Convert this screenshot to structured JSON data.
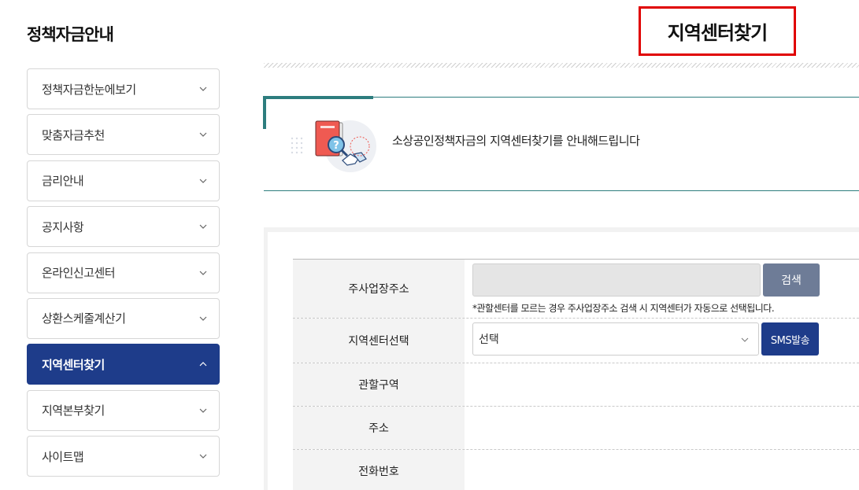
{
  "sidebar": {
    "title": "정책자금안내",
    "items": [
      {
        "label": "정책자금한눈에보기",
        "active": false
      },
      {
        "label": "맞춤자금추천",
        "active": false
      },
      {
        "label": "금리안내",
        "active": false
      },
      {
        "label": "공지사항",
        "active": false
      },
      {
        "label": "온라인신고센터",
        "active": false
      },
      {
        "label": "상환스케줄계산기",
        "active": false
      },
      {
        "label": "지역센터찾기",
        "active": true
      },
      {
        "label": "지역본부찾기",
        "active": false
      },
      {
        "label": "사이트맵",
        "active": false
      }
    ]
  },
  "header": {
    "title": "지역센터찾기"
  },
  "banner": {
    "text": "소상공인정책자금의 지역센터찾기를 안내해드립니다",
    "icon": "book-search-handshake-icon"
  },
  "form": {
    "rows": {
      "address": {
        "label": "주사업장주소",
        "input_value": "",
        "search_label": "검색",
        "hint": "*관할센터를 모르는 경우 주사업장주소 검색 시 지역센터가 자동으로 선택됩니다."
      },
      "center": {
        "label": "지역센터선택",
        "selected": "선택",
        "sms_label": "SMS발송"
      },
      "district": {
        "label": "관할구역",
        "value": ""
      },
      "addr": {
        "label": "주소",
        "value": ""
      },
      "phone": {
        "label": "전화번호",
        "value": ""
      }
    }
  },
  "colors": {
    "primary": "#1e3c8a",
    "teal": "#2d7d7e",
    "highlight": "#e00000",
    "search_button": "#6e7c97"
  }
}
